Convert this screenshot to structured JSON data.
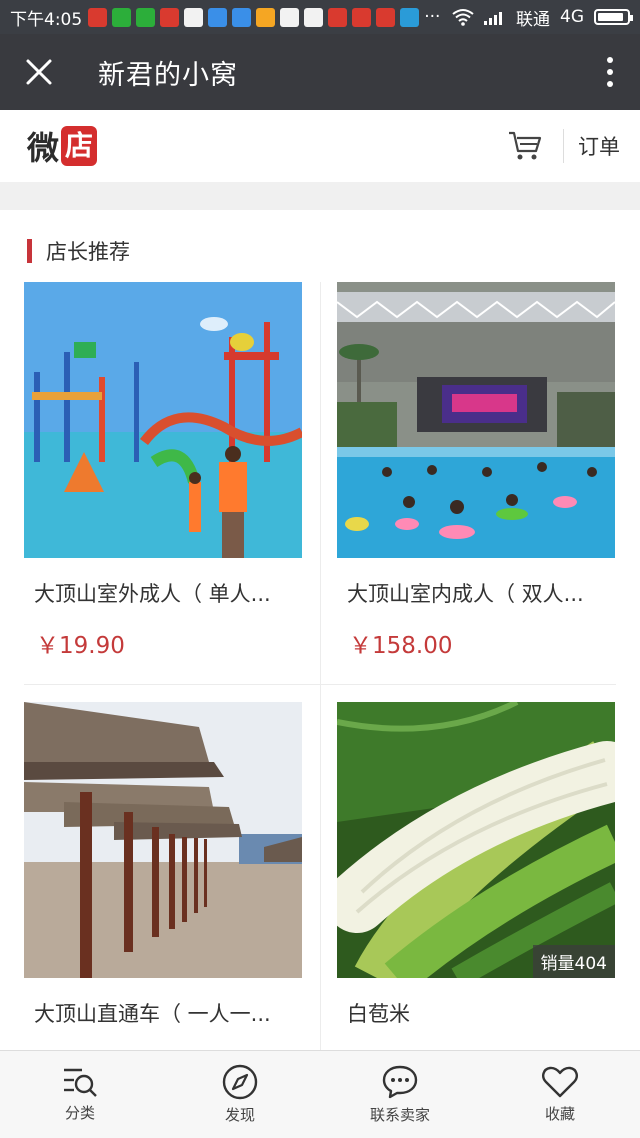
{
  "status_bar": {
    "time": "下午4:05",
    "carrier": "联通",
    "network": "4G",
    "battery_level": 0.9,
    "app_icon_colors": [
      "#d93a2f",
      "#2cae3a",
      "#2cae3a",
      "#d93a2f",
      "#f2f2f2",
      "#3a8fe8",
      "#3a8fe8",
      "#f5a623",
      "#f2f2f2",
      "#f2f2f2",
      "#d93a2f",
      "#d93a2f",
      "#d93a2f",
      "#2a9bd8"
    ]
  },
  "title_bar": {
    "title": "新君的小窝"
  },
  "shop_header": {
    "logo_part1": "微",
    "logo_part2": "店",
    "orders_label": "订单",
    "accent_color": "#d42e2e"
  },
  "section": {
    "title": "店长推荐"
  },
  "products": [
    {
      "name": "大顶山室外成人（ 单人...",
      "price": "￥19.90",
      "image": "outdoor-waterpark"
    },
    {
      "name": "大顶山室内成人（ 双人...",
      "price": "￥158.00",
      "image": "indoor-waterpark"
    },
    {
      "name": "大顶山直通车（ 一人一...",
      "price": "",
      "image": "beach-umbrellas"
    },
    {
      "name": "白苞米",
      "price": "",
      "image": "white-corn",
      "sales": "销量404"
    }
  ],
  "bottom_nav": [
    {
      "label": "分类",
      "icon": "category-search-icon"
    },
    {
      "label": "发现",
      "icon": "compass-icon"
    },
    {
      "label": "联系卖家",
      "icon": "chat-bubble-icon"
    },
    {
      "label": "收藏",
      "icon": "heart-icon"
    }
  ]
}
